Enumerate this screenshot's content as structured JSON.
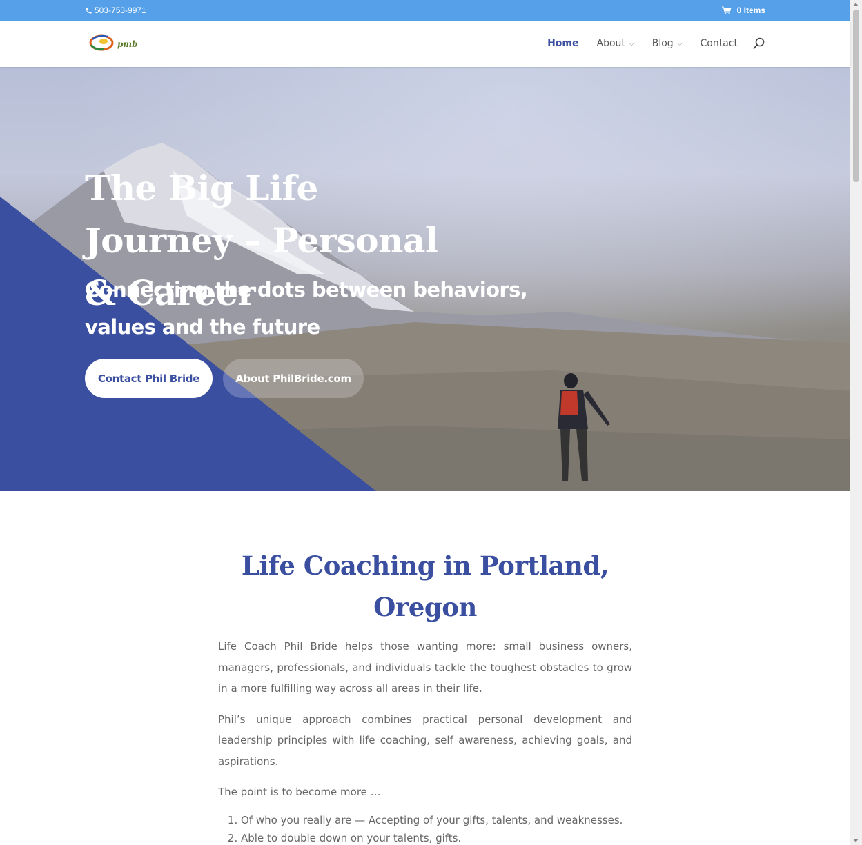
{
  "topbar": {
    "phone": "503-753-9971",
    "cart_label": "0 Items",
    "icons": {
      "phone": "phone-icon",
      "cart": "cart-icon"
    }
  },
  "header": {
    "logo_text": "pmb",
    "nav": [
      {
        "label": "Home",
        "active": true
      },
      {
        "label": "About",
        "dropdown": true
      },
      {
        "label": "Blog",
        "dropdown": true
      },
      {
        "label": "Contact"
      }
    ],
    "search_icon": "search-icon"
  },
  "hero": {
    "title": "The Big Life Journey – Personal & Career",
    "subtitle": "Connecting the dots between behaviors, values and the future",
    "primary_button": "Contact Phil Bride",
    "secondary_button": "About PhilBride.com"
  },
  "content": {
    "heading": "Life Coaching in Portland, Oregon",
    "paragraphs": [
      "Life Coach Phil Bride helps those wanting more: small business owners, managers, professionals, and individuals tackle the toughest obstacles to grow in a more fulfilling way across all areas in their life.",
      "Phil’s unique approach combines practical personal development and leadership principles with life coaching, self awareness, achieving goals, and aspirations.",
      "The point is to become more …"
    ],
    "list": [
      "Of who you really are — Accepting of your gifts, talents, and weaknesses.",
      "Able to double down on your talents, gifts."
    ]
  },
  "colors": {
    "topbar": "#55a0e8",
    "accent": "#3b4fa0",
    "hero_triangle": "#3b4fa0"
  }
}
